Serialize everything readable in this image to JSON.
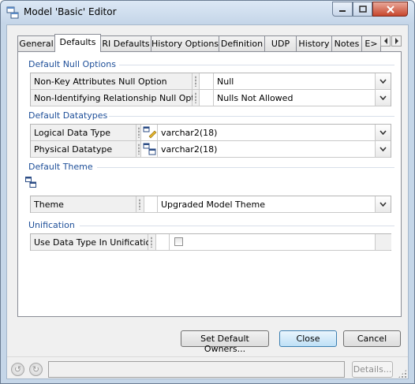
{
  "window": {
    "title": "Model 'Basic' Editor",
    "icon": "model-editor-icon"
  },
  "tabs": [
    {
      "label": "General"
    },
    {
      "label": "Defaults"
    },
    {
      "label": "RI Defaults"
    },
    {
      "label": "History Options"
    },
    {
      "label": "Definition"
    },
    {
      "label": "UDP"
    },
    {
      "label": "History"
    },
    {
      "label": "Notes"
    },
    {
      "label": "E>"
    }
  ],
  "active_tab": "Defaults",
  "sections": {
    "null_options": {
      "title": "Default Null Options",
      "rows": [
        {
          "label": "Non-Key Attributes Null Option",
          "value": "Null"
        },
        {
          "label": "Non-Identifying Relationship Null Option",
          "value": "Nulls Not Allowed"
        }
      ]
    },
    "datatypes": {
      "title": "Default Datatypes",
      "rows": [
        {
          "label": "Logical Data Type",
          "value": "varchar2(18)"
        },
        {
          "label": "Physical Datatype",
          "value": "varchar2(18)"
        }
      ]
    },
    "theme": {
      "title": "Default Theme",
      "rows": [
        {
          "label": "Theme",
          "value": "Upgraded Model Theme"
        }
      ]
    },
    "unification": {
      "title": "Unification",
      "rows": [
        {
          "label": "Use Data Type In Unification",
          "checked": false
        }
      ]
    }
  },
  "buttons": {
    "set_default_owners": "Set Default Owners...",
    "close": "Close",
    "cancel": "Cancel"
  },
  "status_bar": {
    "details": "Details..."
  },
  "colors": {
    "section_title": "#1e4f99",
    "window_frame": "#c5d6e8"
  }
}
